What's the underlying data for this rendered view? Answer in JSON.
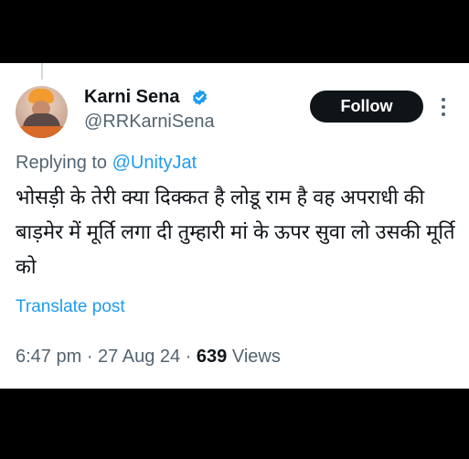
{
  "author": {
    "name": "Karni Sena",
    "handle": "@RRKarniSena",
    "verified_color": "#1d9bf0"
  },
  "actions": {
    "follow_label": "Follow",
    "more_icon": "more-vertical-icon"
  },
  "reply": {
    "prefix": "Replying to ",
    "mention": "@UnityJat"
  },
  "post": {
    "text": "भोसड़ी के तेरी क्या दिक्कत है लोडू राम है वह अपराधी की बाड़मेर में मूर्ति लगा दी तुम्हारी मां के ऊपर सुवा लो उसकी मूर्ति को"
  },
  "translate_label": "Translate post",
  "meta": {
    "time": "6:47 pm",
    "date": "27 Aug 24",
    "views_count": "639",
    "views_label": "Views",
    "separator": " · "
  }
}
